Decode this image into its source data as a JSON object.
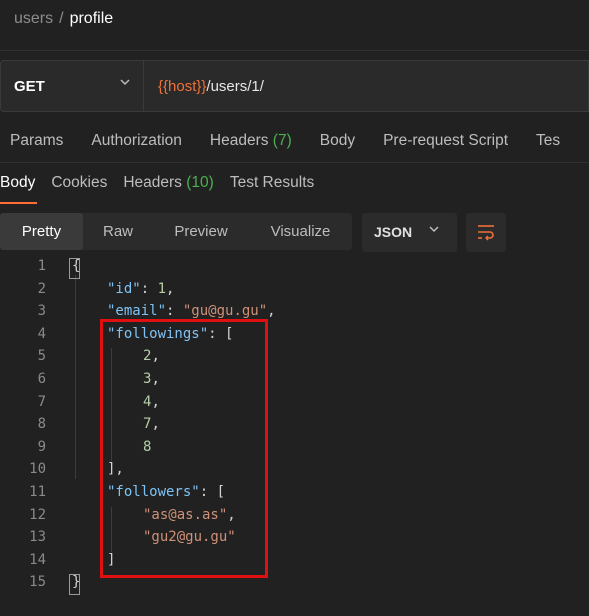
{
  "breadcrumb": {
    "collection": "users",
    "separator": "/",
    "request": "profile"
  },
  "request": {
    "method": "GET",
    "url_variable": "{{host}}",
    "url_path": "/users/1/"
  },
  "request_tabs": [
    {
      "label": "Params",
      "count": ""
    },
    {
      "label": "Authorization",
      "count": ""
    },
    {
      "label": "Headers",
      "count": "(7)"
    },
    {
      "label": "Body",
      "count": ""
    },
    {
      "label": "Pre-request Script",
      "count": ""
    },
    {
      "label": "Tes",
      "count": ""
    }
  ],
  "response_tabs": [
    {
      "label": "Body",
      "count": "",
      "active": true
    },
    {
      "label": "Cookies",
      "count": ""
    },
    {
      "label": "Headers",
      "count": "(10)"
    },
    {
      "label": "Test Results",
      "count": ""
    }
  ],
  "view_modes": [
    "Pretty",
    "Raw",
    "Preview",
    "Visualize"
  ],
  "active_view_mode": "Pretty",
  "format": "JSON",
  "icons": {
    "method_dropdown": "chevron-down-icon",
    "format_dropdown": "chevron-down-icon",
    "wrap": "wrap-lines-icon"
  },
  "colors": {
    "accent": "#ff6c37",
    "variable": "#f0703a",
    "count": "#4caf50",
    "highlight": "#e01010"
  },
  "code_lines": [
    {
      "num": "1",
      "text": "{"
    },
    {
      "num": "2",
      "key": "\"id\"",
      "rest": ": ",
      "value": "1",
      "vtype": "n",
      "tail": ","
    },
    {
      "num": "3",
      "key": "\"email\"",
      "rest": ": ",
      "value": "\"gu@gu.gu\"",
      "vtype": "s",
      "tail": ","
    },
    {
      "num": "4",
      "key": "\"followings\"",
      "rest": ": ["
    },
    {
      "num": "5",
      "value": "2",
      "vtype": "n",
      "tail": ","
    },
    {
      "num": "6",
      "value": "3",
      "vtype": "n",
      "tail": ","
    },
    {
      "num": "7",
      "value": "4",
      "vtype": "n",
      "tail": ","
    },
    {
      "num": "8",
      "value": "7",
      "vtype": "n",
      "tail": ","
    },
    {
      "num": "9",
      "value": "8",
      "vtype": "n"
    },
    {
      "num": "10",
      "text": "],"
    },
    {
      "num": "11",
      "key": "\"followers\"",
      "rest": ": ["
    },
    {
      "num": "12",
      "value": "\"as@as.as\"",
      "vtype": "s",
      "tail": ","
    },
    {
      "num": "13",
      "value": "\"gu2@gu.gu\"",
      "vtype": "s"
    },
    {
      "num": "14",
      "text": "]"
    },
    {
      "num": "15",
      "text": "}"
    }
  ]
}
